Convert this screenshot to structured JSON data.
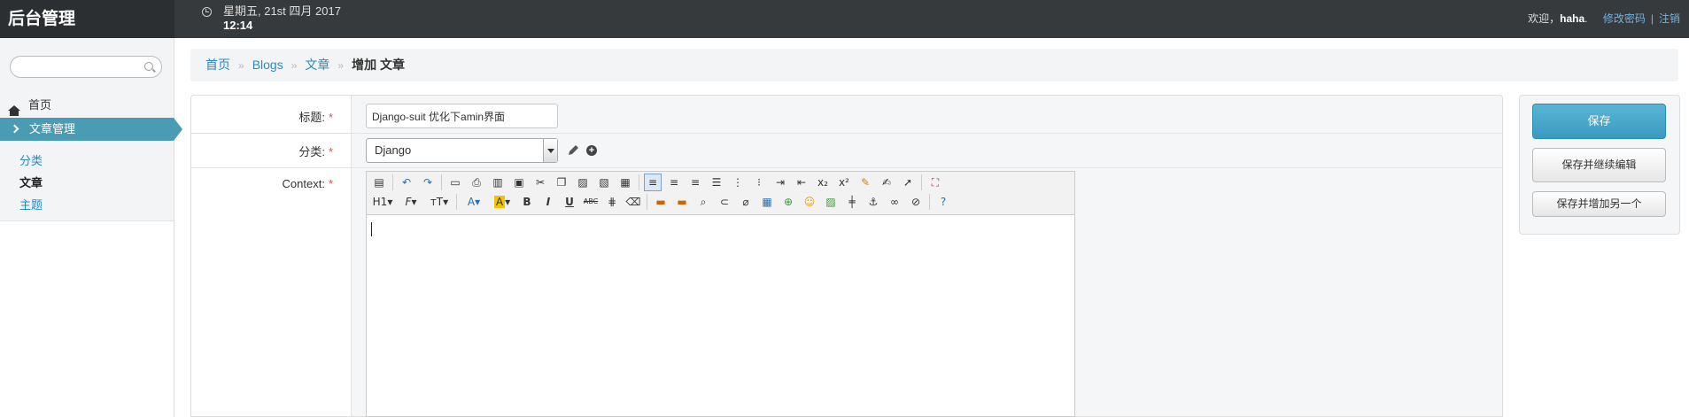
{
  "header": {
    "brand": "后台管理",
    "date": "星期五, 21st 四月 2017",
    "time": "12:14",
    "welcome": "欢迎，",
    "username": "haha",
    "dot": ".",
    "change_password": "修改密码",
    "separator": "|",
    "logout": "注销"
  },
  "sidebar": {
    "search_placeholder": "",
    "home": "首页",
    "active_section": "文章管理",
    "sub_items": [
      {
        "label": "分类"
      },
      {
        "label": "文章"
      },
      {
        "label": "主题"
      }
    ]
  },
  "breadcrumb": {
    "items": [
      "首页",
      "Blogs",
      "文章"
    ],
    "divider": "»",
    "current": "增加 文章"
  },
  "form": {
    "title_label": "标题:",
    "title_value": "Django-suit 优化下amin界面",
    "category_label": "分类:",
    "category_value": "Django",
    "context_label": "Context:",
    "required_mark": "*"
  },
  "toolbar": {
    "heading": "H1",
    "font_family": "F",
    "font_size": "тT",
    "font_color": "A",
    "highlight": "A",
    "bold": "B",
    "italic": "I",
    "underline": "U",
    "strikethrough": "ABC",
    "selected_tool": "align-left",
    "highlight_color": "#f5c400"
  },
  "actions": {
    "save": "保存",
    "save_continue": "保存并继续编辑",
    "save_add_another": "保存并增加另一个"
  },
  "colors": {
    "header_bg": "#373a3d",
    "accent": "#4a9bb4",
    "link": "#2a8ac0",
    "required": "#d9534f"
  }
}
